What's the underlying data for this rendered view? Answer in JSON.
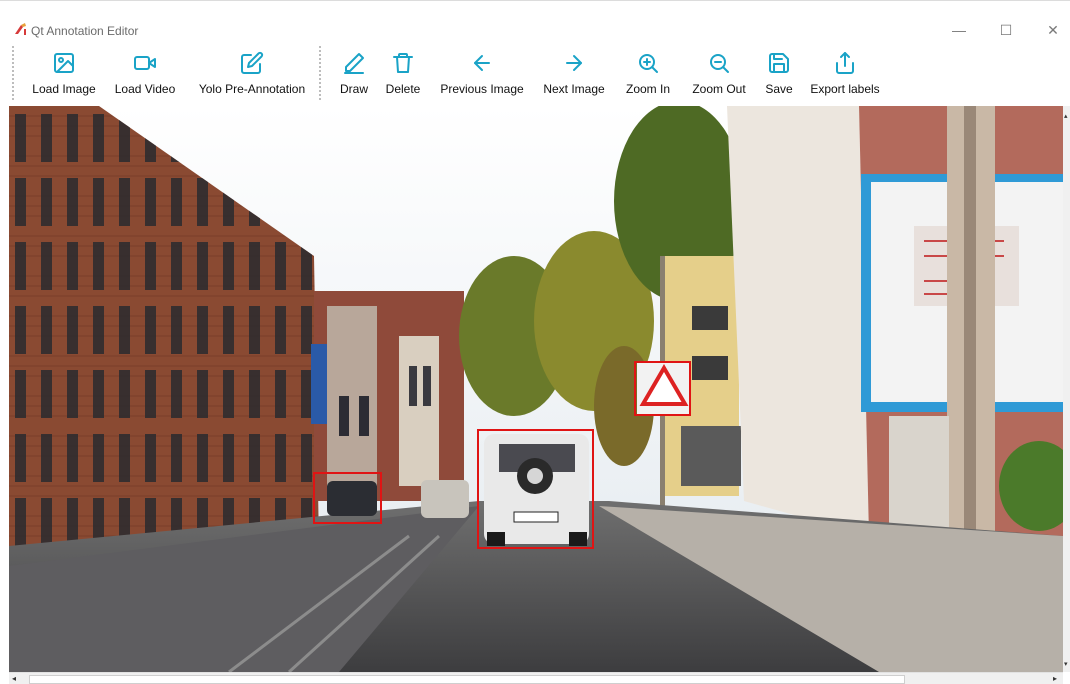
{
  "window": {
    "title": "Qt Annotation Editor",
    "controls": {
      "minimize": "—",
      "maximize": "☐",
      "close": "✕"
    }
  },
  "toolbar": {
    "accent": "#1aa3c7",
    "load_image": "Load Image",
    "load_video": "Load Video",
    "yolo": "Yolo Pre-Annotation",
    "draw": "Draw",
    "delete": "Delete",
    "previous": "Previous Image",
    "next": "Next Image",
    "zoom_in": "Zoom In",
    "zoom_out": "Zoom Out",
    "save": "Save",
    "export": "Export labels"
  },
  "canvas": {
    "bbox_color": "#e01414",
    "annotations": [
      "car",
      "suv",
      "traffic-sign"
    ]
  },
  "scrollbars": {
    "left_arrow": "◂",
    "right_arrow": "▸",
    "up_arrow": "▴",
    "down_arrow": "▾"
  }
}
